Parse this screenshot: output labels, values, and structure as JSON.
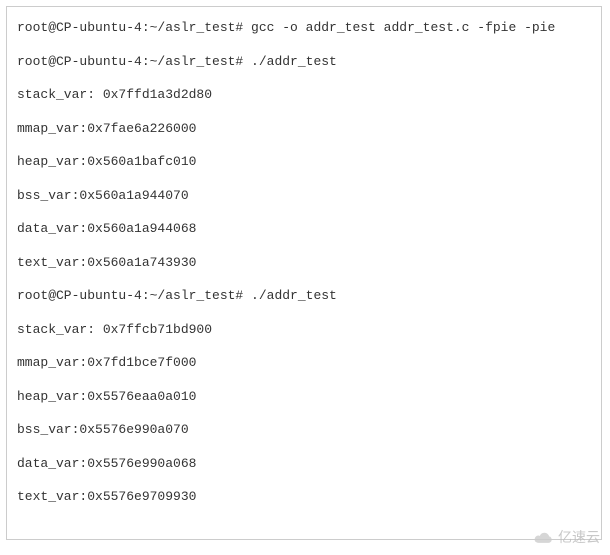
{
  "terminal": {
    "lines": [
      "root@CP-ubuntu-4:~/aslr_test# gcc -o addr_test addr_test.c -fpie -pie",
      "root@CP-ubuntu-4:~/aslr_test# ./addr_test",
      "stack_var: 0x7ffd1a3d2d80",
      "mmap_var:0x7fae6a226000",
      "heap_var:0x560a1bafc010",
      "bss_var:0x560a1a944070",
      "data_var:0x560a1a944068",
      "text_var:0x560a1a743930",
      "root@CP-ubuntu-4:~/aslr_test# ./addr_test",
      "stack_var: 0x7ffcb71bd900",
      "mmap_var:0x7fd1bce7f000",
      "heap_var:0x5576eaa0a010",
      "bss_var:0x5576e990a070",
      "data_var:0x5576e990a068",
      "text_var:0x5576e9709930"
    ]
  },
  "watermark": {
    "text": "亿速云"
  }
}
